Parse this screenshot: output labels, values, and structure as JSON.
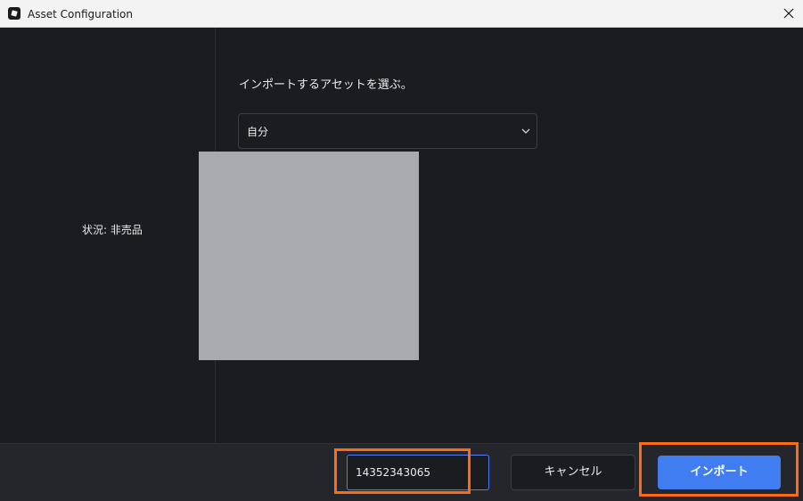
{
  "window": {
    "title": "Asset Configuration",
    "icons": {
      "app": "roblox-studio-icon",
      "close": "close-icon"
    }
  },
  "left_panel": {
    "status_text": "状況: 非売品"
  },
  "main": {
    "prompt": "インポートするアセットを選ぶ。",
    "owner_dropdown": {
      "selected": "自分",
      "icon": "chevron-down-icon"
    },
    "preview": {
      "color": "#a9aaad"
    }
  },
  "footer": {
    "asset_id_value": "14352343065",
    "cancel_label": "キャンセル",
    "import_label": "インポート"
  },
  "colors": {
    "background": "#1b1c20",
    "footer": "#24262b",
    "accent": "#3f7df0",
    "highlight": "#ff6a14",
    "titlebar": "#f3f3f3"
  }
}
